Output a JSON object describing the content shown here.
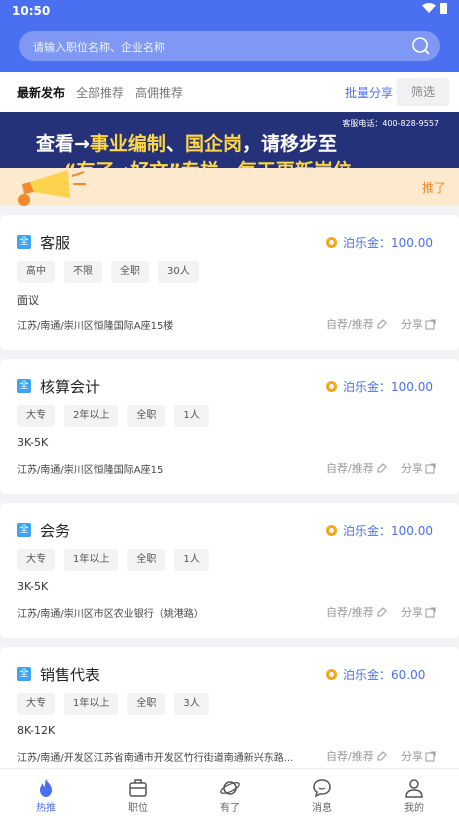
{
  "status_bar": {
    "time": "10:50"
  },
  "search": {
    "placeholder": "请输入职位名称、企业名称"
  },
  "tabs": [
    {
      "label": "最新发布",
      "active": true
    },
    {
      "label": "全部推荐",
      "active": false
    },
    {
      "label": "高佣推荐",
      "active": false
    }
  ],
  "actions": {
    "batch_share": "批量分享",
    "filter": "筛选"
  },
  "banner": {
    "hotline": "客服电话：400-828-9557",
    "text_prefix": "查看→",
    "highlight_1": "事业编制",
    "separator": "、",
    "highlight_2": "国企岗",
    "text_suffix": "，请移步至",
    "second_line_partial": "“有了→好文”专栏，每天更新岗位~"
  },
  "notice": {
    "more": "推了"
  },
  "jobs": [
    {
      "badge": "全",
      "title": "客服",
      "bonus": "泊乐金：100.00",
      "tags": [
        "高中",
        "不限",
        "全职",
        "30人"
      ],
      "salary": "面议",
      "address": "江苏/南通/崇川区恒隆国际A座15楼",
      "self_recommend": "自荐/推荐",
      "share": "分享"
    },
    {
      "badge": "全",
      "title": "核算会计",
      "bonus": "泊乐金：100.00",
      "tags": [
        "大专",
        "2年以上",
        "全职",
        "1人"
      ],
      "salary": "3K-5K",
      "address": "江苏/南通/崇川区恒隆国际A座15",
      "self_recommend": "自荐/推荐",
      "share": "分享"
    },
    {
      "badge": "全",
      "title": "会务",
      "bonus": "泊乐金：100.00",
      "tags": [
        "大专",
        "1年以上",
        "全职",
        "1人"
      ],
      "salary": "3K-5K",
      "address": "江苏/南通/崇川区市区农业银行（姚港路）",
      "self_recommend": "自荐/推荐",
      "share": "分享"
    },
    {
      "badge": "全",
      "title": "销售代表",
      "bonus": "泊乐金：60.00",
      "tags": [
        "大专",
        "1年以上",
        "全职",
        "3人"
      ],
      "salary": "8K-12K",
      "address": "江苏/南通/开发区江苏省南通市开发区竹行街道南通新兴东路...",
      "self_recommend": "自荐/推荐",
      "share": "分享"
    }
  ],
  "bottom_nav": [
    {
      "label": "热推",
      "icon": "flame-icon",
      "active": true
    },
    {
      "label": "职位",
      "icon": "briefcase-icon",
      "active": false
    },
    {
      "label": "有了",
      "icon": "planet-icon",
      "active": false
    },
    {
      "label": "消息",
      "icon": "chat-icon",
      "active": false
    },
    {
      "label": "我的",
      "icon": "user-icon",
      "active": false
    }
  ],
  "colors": {
    "primary": "#4a6ff0",
    "coin": "#f7a520",
    "notice_bg": "#fde9cd",
    "banner_bg": "#25327a"
  }
}
